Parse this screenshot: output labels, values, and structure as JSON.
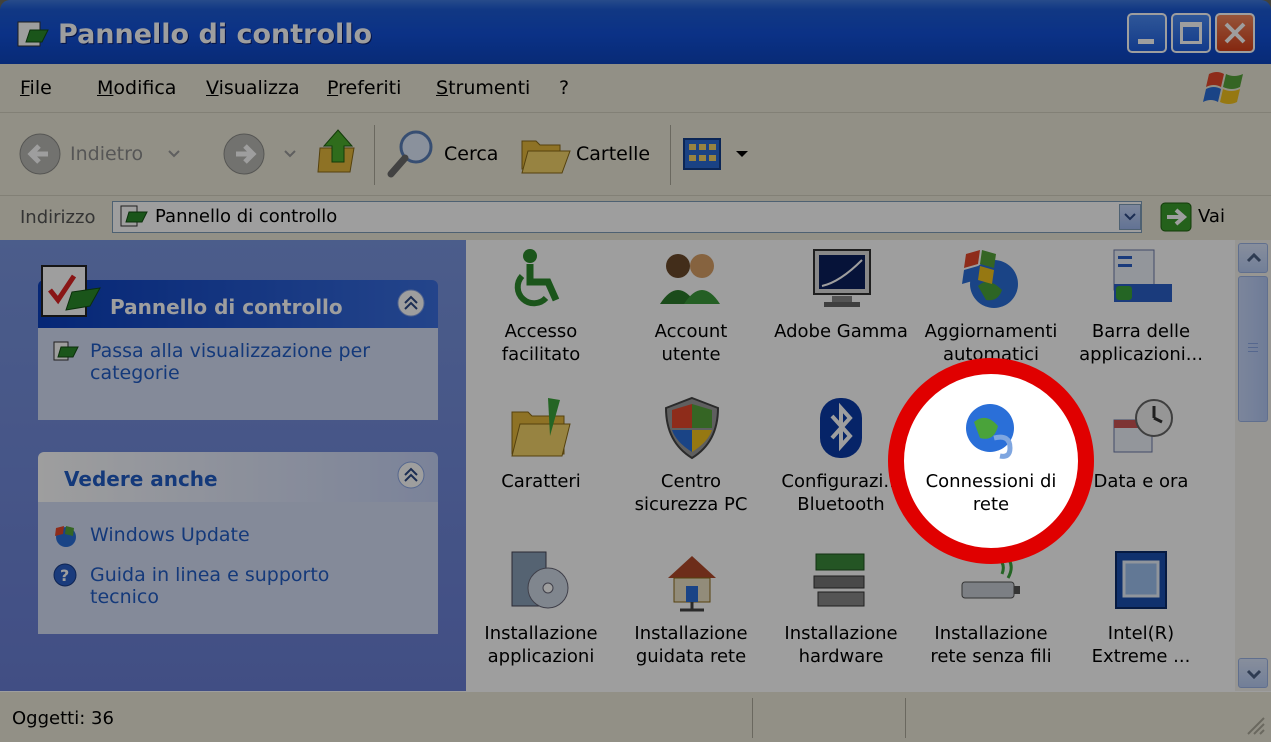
{
  "window": {
    "title": "Pannello di controllo",
    "buttons": [
      "minimize",
      "maximize",
      "close"
    ]
  },
  "menubar": {
    "items": [
      {
        "label": "File"
      },
      {
        "label": "Modifica"
      },
      {
        "label": "Visualizza"
      },
      {
        "label": "Preferiti"
      },
      {
        "label": "Strumenti"
      },
      {
        "label": "?"
      }
    ]
  },
  "toolbar": {
    "back_label": "Indietro",
    "search_label": "Cerca",
    "folders_label": "Cartelle"
  },
  "addressbar": {
    "label": "Indirizzo",
    "value": "Pannello di controllo",
    "go_label": "Vai"
  },
  "leftpane": {
    "panel1": {
      "title": "Pannello di controllo",
      "link_line1": "Passa alla visualizzazione per",
      "link_line2": "categorie"
    },
    "panel2": {
      "title": "Vedere anche",
      "link1": "Windows Update",
      "link2_line1": "Guida in linea e supporto",
      "link2_line2": "tecnico"
    }
  },
  "icons": [
    {
      "label1": "Accesso",
      "label2": "facilitato",
      "icon": "accessibility-icon"
    },
    {
      "label1": "Account",
      "label2": "utente",
      "icon": "user-accounts-icon"
    },
    {
      "label1": "Adobe Gamma",
      "label2": "",
      "icon": "monitor-icon"
    },
    {
      "label1": "Aggiornamenti",
      "label2": "automatici",
      "icon": "windows-globe-icon"
    },
    {
      "label1": "Barra delle",
      "label2": "applicazioni...",
      "icon": "taskbar-icon"
    },
    {
      "label1": "Caratteri",
      "label2": "",
      "icon": "fonts-folder-icon"
    },
    {
      "label1": "Centro",
      "label2": "sicurezza PC",
      "icon": "security-shield-icon"
    },
    {
      "label1": "Configurazi...",
      "label2": "Bluetooth",
      "icon": "bluetooth-icon"
    },
    {
      "label1": "Connessioni di",
      "label2": "rete",
      "icon": "network-globe-icon"
    },
    {
      "label1": "Data e ora",
      "label2": "",
      "icon": "clock-calendar-icon"
    },
    {
      "label1": "Installazione",
      "label2": "applicazioni",
      "icon": "install-cd-icon"
    },
    {
      "label1": "Installazione",
      "label2": "guidata rete",
      "icon": "home-network-icon"
    },
    {
      "label1": "Installazione",
      "label2": "hardware",
      "icon": "hardware-icon"
    },
    {
      "label1": "Installazione",
      "label2": "rete senza fili",
      "icon": "wireless-icon"
    },
    {
      "label1": "Intel(R)",
      "label2": "Extreme ...",
      "icon": "intel-graphics-icon"
    }
  ],
  "statusbar": {
    "text": "Oggetti: 36"
  },
  "highlight": {
    "color": "#e00000",
    "target": "Connessioni di rete"
  }
}
